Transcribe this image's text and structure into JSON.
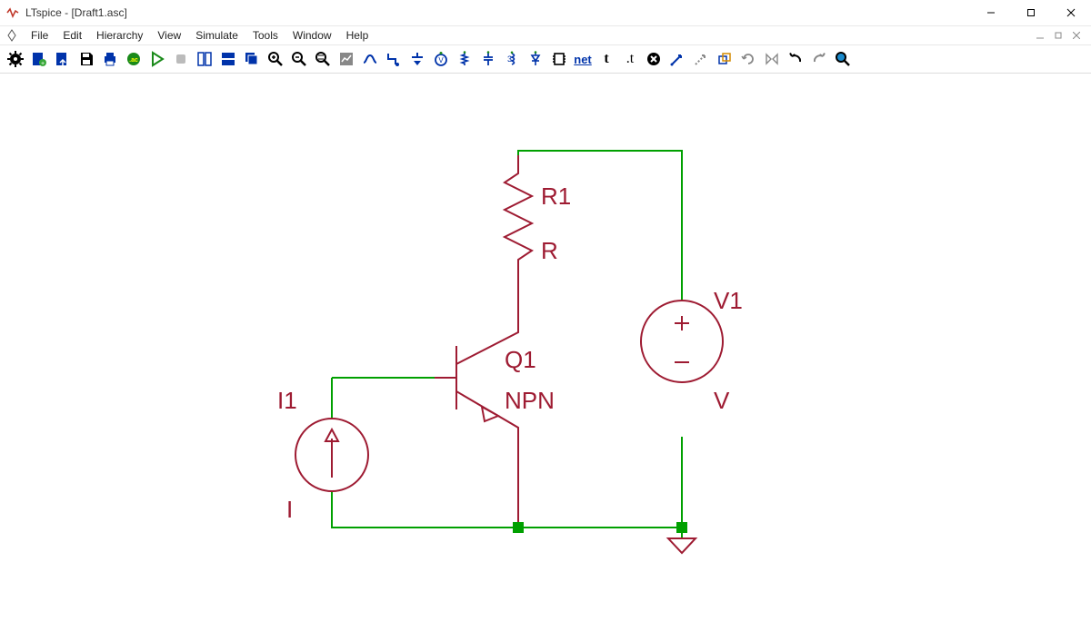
{
  "window": {
    "title": "LTspice - [Draft1.asc]"
  },
  "menu": {
    "file": "File",
    "edit": "Edit",
    "hierarchy": "Hierarchy",
    "view": "View",
    "simulate": "Simulate",
    "tools": "Tools",
    "window": "Window",
    "help": "Help"
  },
  "schematic": {
    "r1_name": "R1",
    "r1_val": "R",
    "q1_name": "Q1",
    "q1_val": "NPN",
    "i1_name": "I1",
    "i1_val": "I",
    "v1_name": "V1",
    "v1_val": "V"
  },
  "chart_data": {
    "type": "diagram",
    "components": [
      {
        "ref": "R1",
        "type": "resistor",
        "value": "R",
        "nodes": [
          "top_rail",
          "q1_collector"
        ]
      },
      {
        "ref": "Q1",
        "type": "npn_bjt",
        "value": "NPN",
        "nodes": {
          "collector": "q1_collector",
          "base": "base_node",
          "emitter": "gnd"
        }
      },
      {
        "ref": "I1",
        "type": "current_source",
        "value": "I",
        "nodes": [
          "gnd",
          "base_node"
        ],
        "direction": "up"
      },
      {
        "ref": "V1",
        "type": "voltage_source",
        "value": "V",
        "nodes": [
          "top_rail",
          "gnd"
        ]
      }
    ],
    "nets": [
      "top_rail",
      "q1_collector",
      "base_node",
      "gnd"
    ]
  }
}
